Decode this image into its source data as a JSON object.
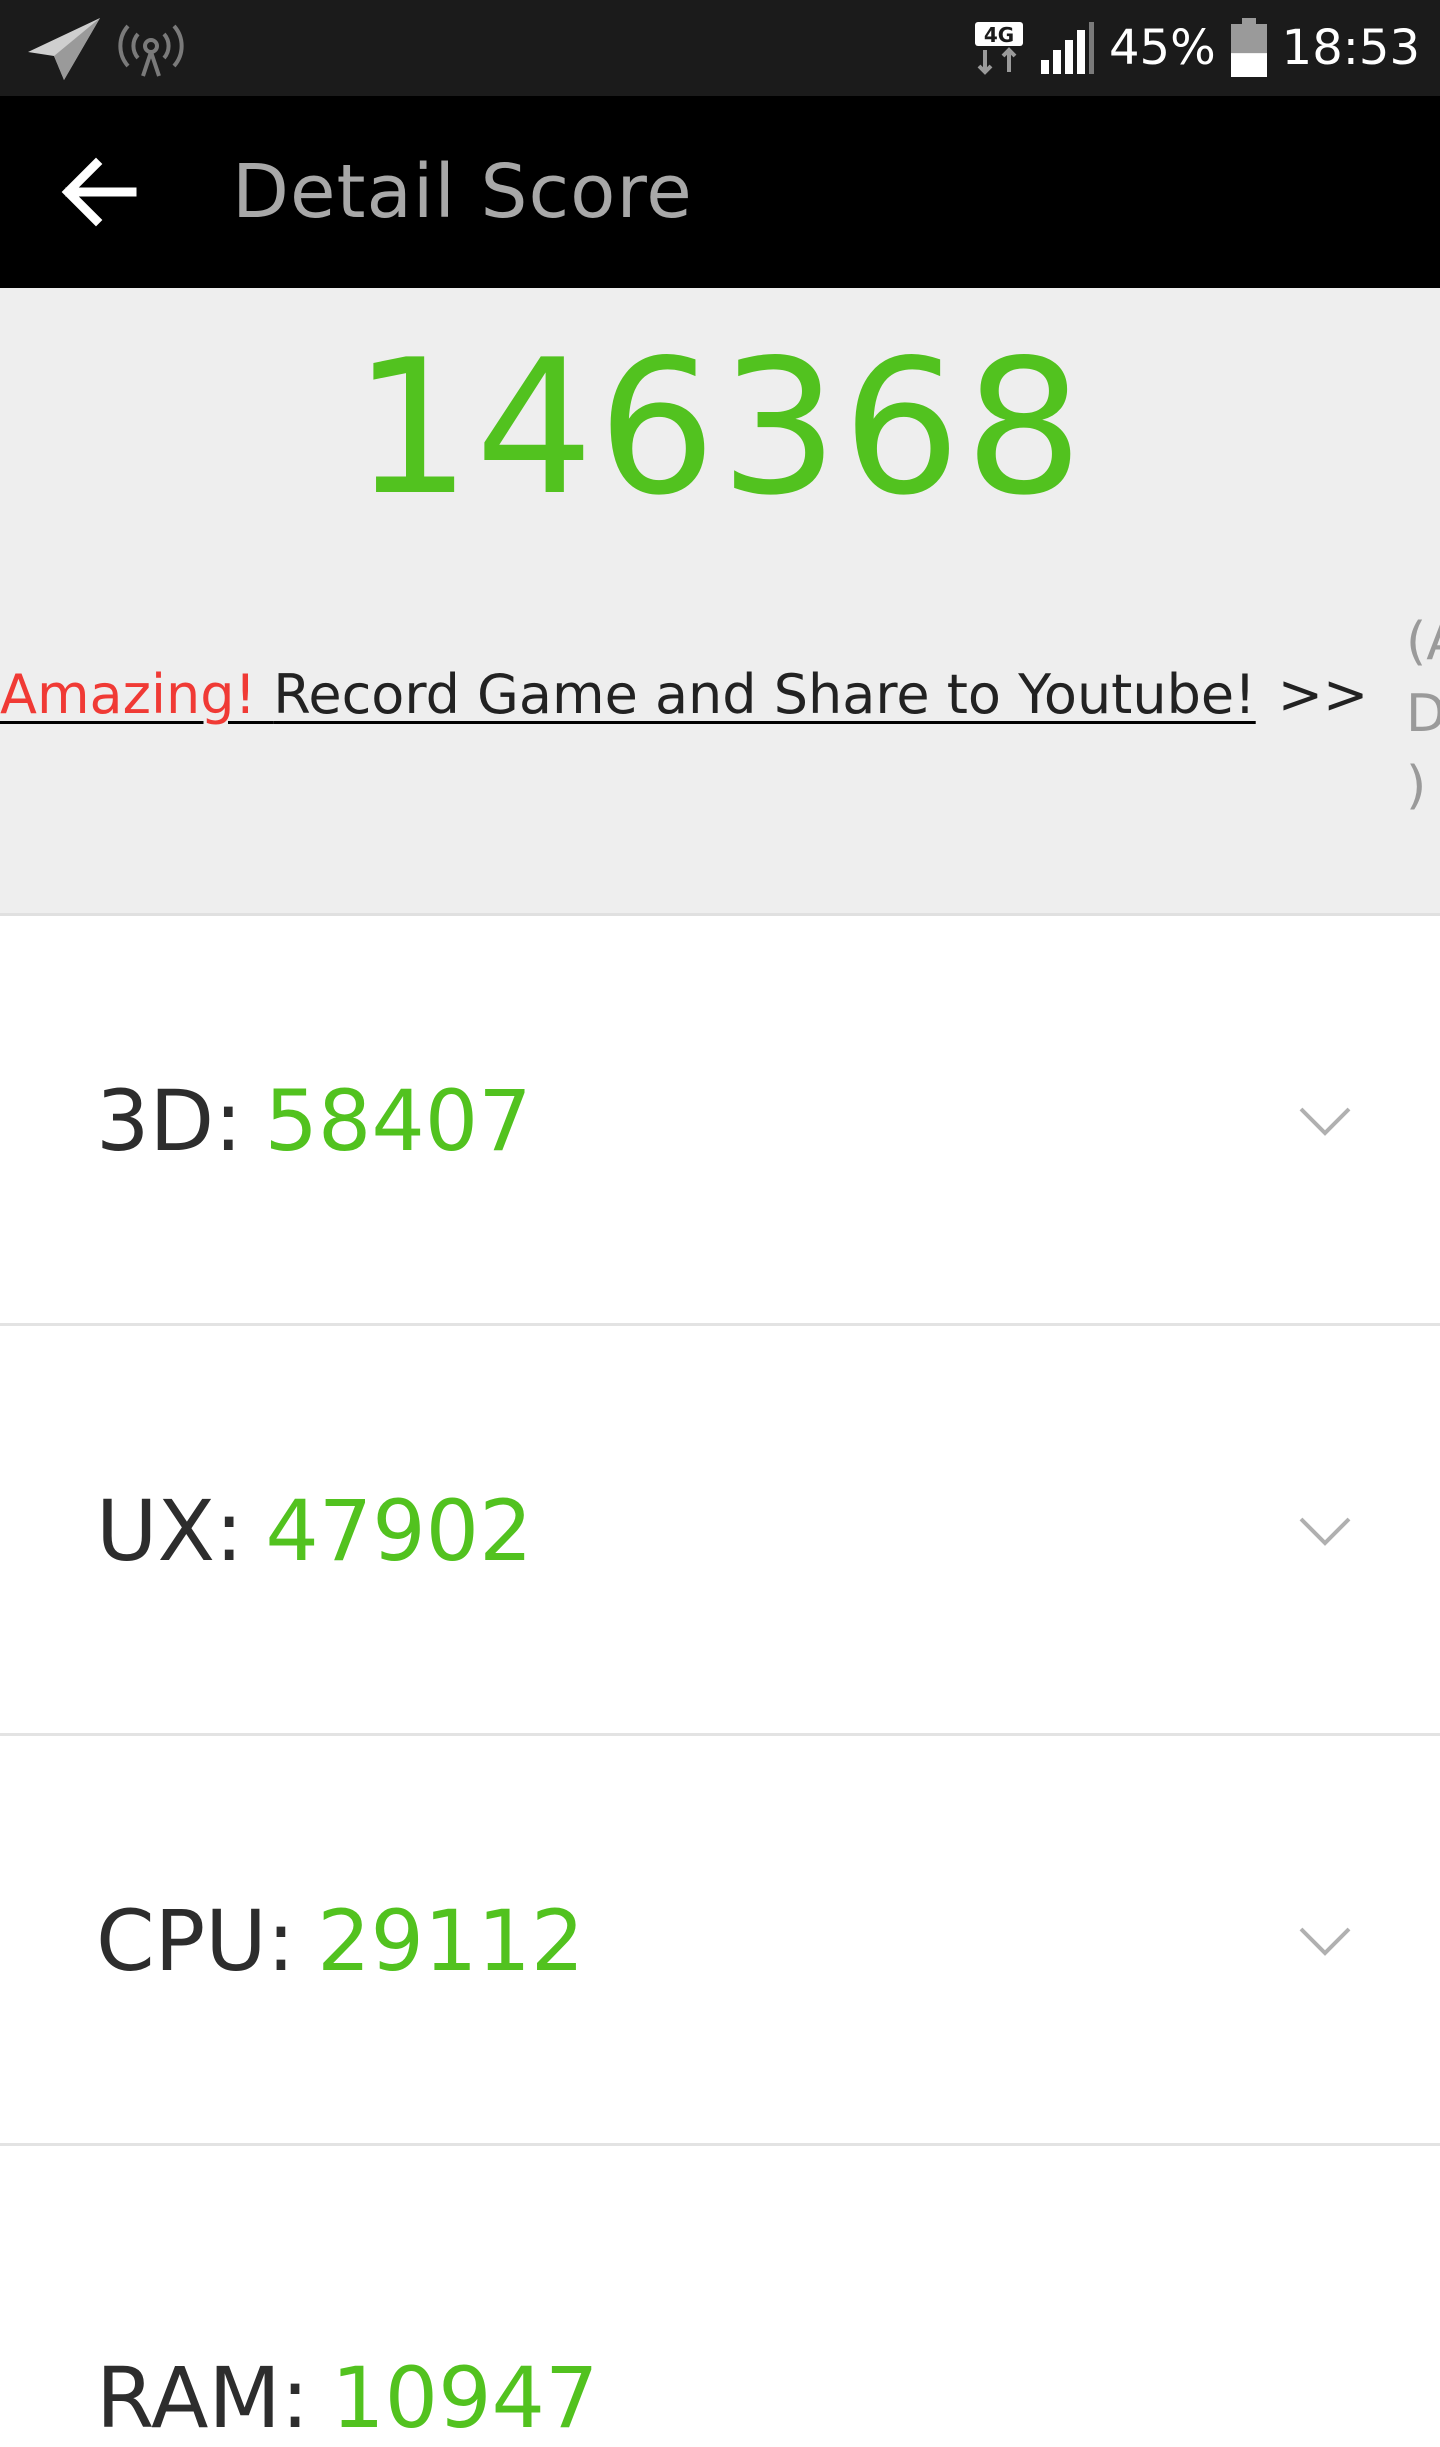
{
  "status_bar": {
    "network_label": "4G",
    "battery_percent": "45%",
    "time": "18:53",
    "icons": [
      "navigation-arrow-icon",
      "hotspot-icon",
      "network-4g-icon",
      "signal-icon",
      "battery-icon"
    ],
    "battery_level": 0.45
  },
  "app_bar": {
    "title": "Detail Score",
    "back_icon": "arrow-left-icon"
  },
  "score": {
    "total": "146368"
  },
  "promo": {
    "highlight": "Amazing! ",
    "text": "Record Game and Share to Youtube!",
    "arrows": ">>",
    "ad_marker": [
      "(A",
      "D",
      ")"
    ]
  },
  "categories": [
    {
      "name": "3D:",
      "value": "58407"
    },
    {
      "name": "UX:",
      "value": "47902"
    },
    {
      "name": "CPU:",
      "value": "29112"
    },
    {
      "name": "RAM:",
      "value": "10947"
    }
  ],
  "colors": {
    "accent_green": "#52c21f",
    "promo_red": "#f03a35",
    "status_bar_bg": "#1b1b1b",
    "app_bar_bg": "#000000",
    "score_panel_bg": "#eeeeee"
  }
}
